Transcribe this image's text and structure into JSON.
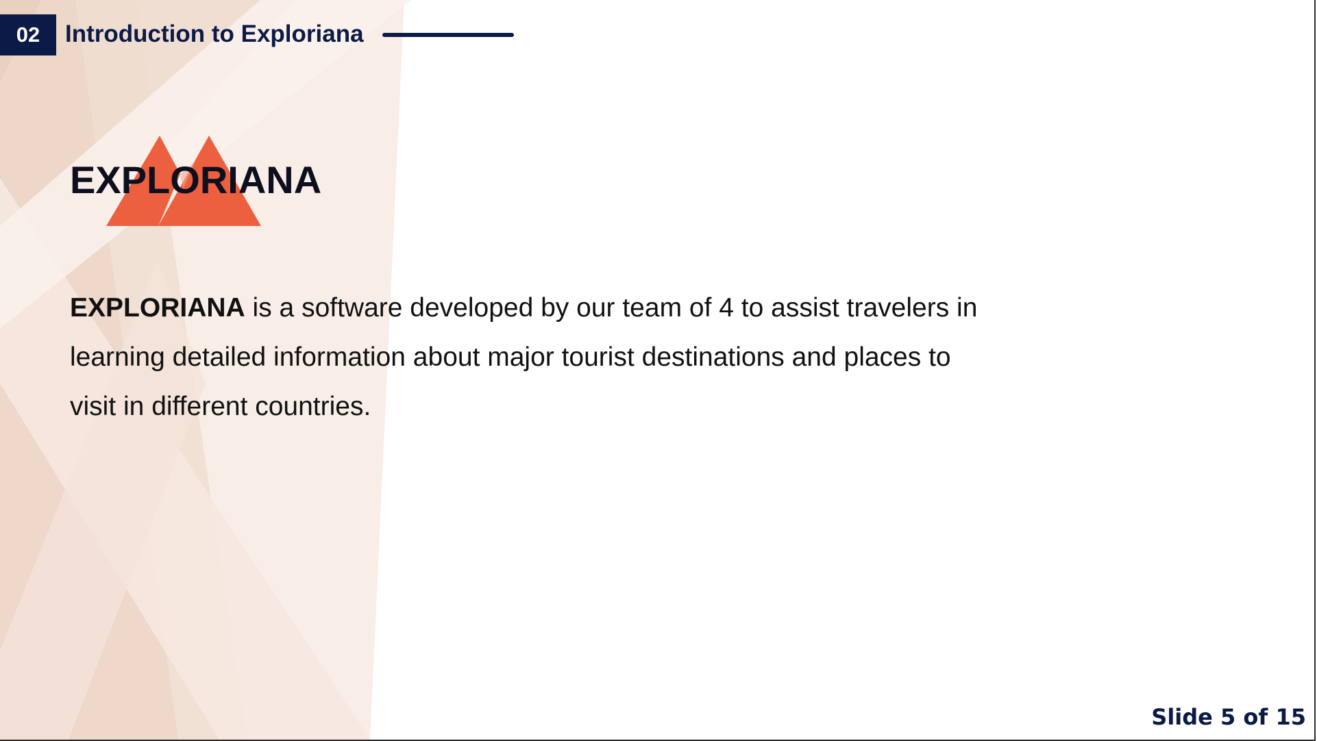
{
  "header": {
    "section_number": "02",
    "section_title": "Introduction to Exploriana"
  },
  "main": {
    "product_name": "EXPLORIANA",
    "description_lead": "EXPLORIANA",
    "description_rest": " is a software developed by our team of 4 to assist travelers in learning detailed information about major tourist destinations and places to visit in different countries."
  },
  "footer": {
    "slide_counter": "Slide 5 of 15"
  },
  "colors": {
    "navy": "#0b1a46",
    "accent_orange": "#ec5f3f",
    "background_peach": "#efdcd0"
  },
  "icons": {
    "logo": "double-mountain-icon"
  }
}
